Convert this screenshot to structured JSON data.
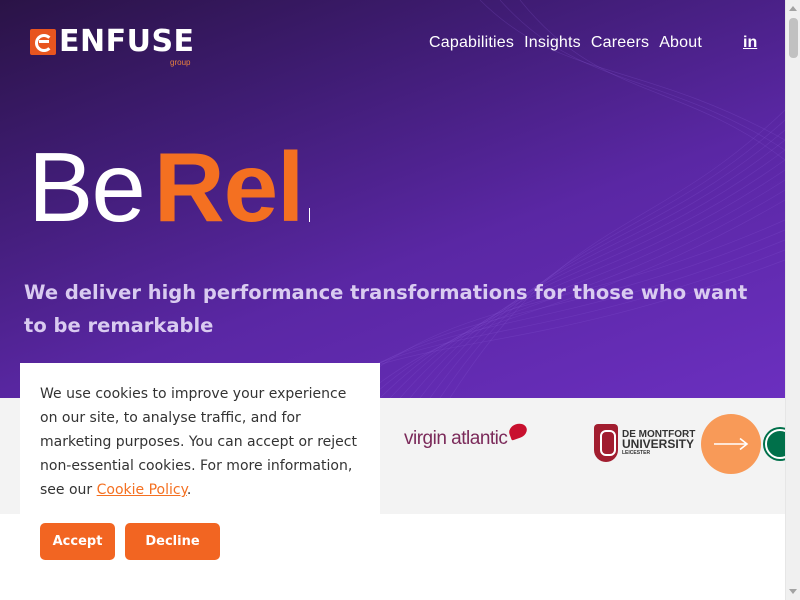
{
  "brand": {
    "name": "ENFUSE",
    "subtitle": "group",
    "accent_color": "#f47021",
    "logo_icon": "enfuse-e-icon"
  },
  "nav": {
    "items": [
      {
        "label": "Capabilities"
      },
      {
        "label": "Insights"
      },
      {
        "label": "Careers"
      },
      {
        "label": "About"
      }
    ],
    "linkedin_label": "in"
  },
  "hero": {
    "headline_prefix": "Be",
    "headline_word": "Rel",
    "tagline": "We deliver high performance transformations for those who want to be remarkable"
  },
  "clients": {
    "virgin_label": "virgin atlantic",
    "dmu_line1": "DE MONTFORT",
    "dmu_line2": "UNIVERSITY",
    "dmu_line3": "LEICESTER",
    "next_icon": "arrow-right-icon"
  },
  "cookie_banner": {
    "text": "We use cookies to improve your experience on our site, to analyse traffic, and for marketing purposes. You can accept or reject non-essential cookies. For more information, see our ",
    "link_label": "Cookie Policy",
    "suffix": ".",
    "accept_label": "Accept",
    "decline_label": "Decline"
  }
}
